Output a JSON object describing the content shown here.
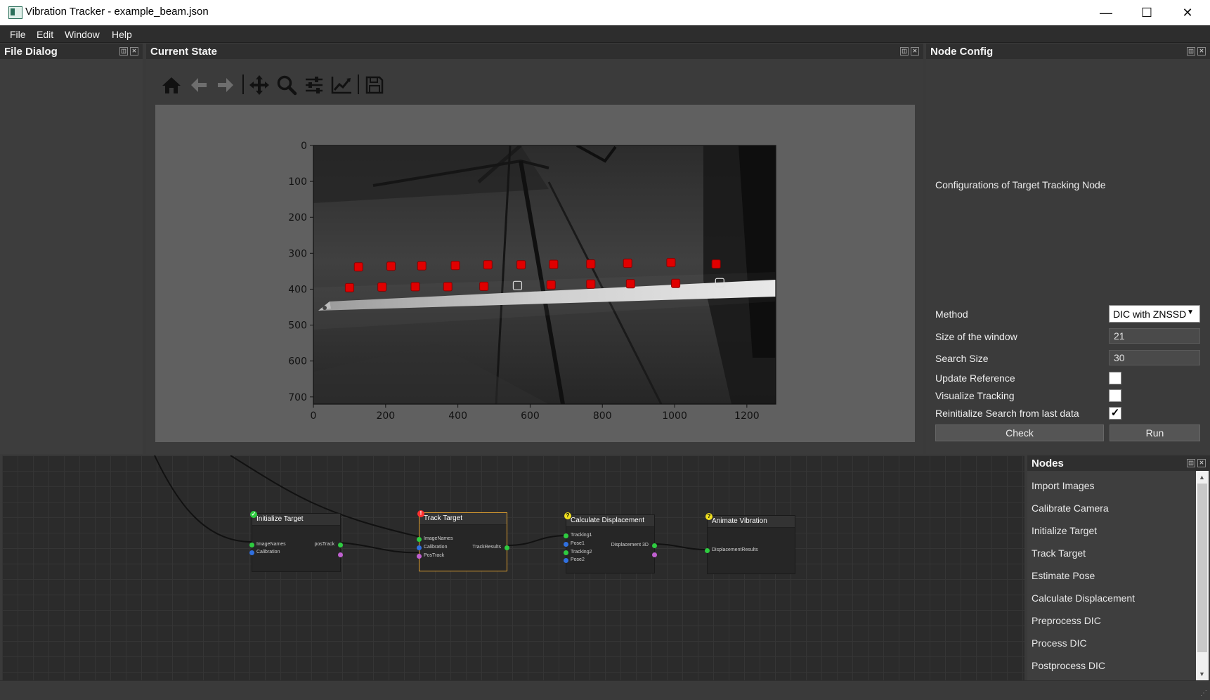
{
  "window": {
    "title": "Vibration Tracker - example_beam.json",
    "minimize_glyph": "—",
    "maximize_glyph": "☐",
    "close_glyph": "✕"
  },
  "menu": [
    "File",
    "Edit",
    "Window",
    "Help"
  ],
  "panels": {
    "file_dialog": "File Dialog",
    "current_state": "Current State",
    "node_config": "Node Config",
    "nodes": "Nodes"
  },
  "toolbar": {
    "icons": [
      "home-icon",
      "back-arrow-icon",
      "forward-arrow-icon",
      "pan-icon",
      "zoom-icon",
      "configure-subplots-icon",
      "edit-axis-icon",
      "save-icon"
    ]
  },
  "chart_data": {
    "type": "image",
    "x_ticks": [
      "0",
      "200",
      "400",
      "600",
      "800",
      "1000",
      "1200"
    ],
    "y_ticks": [
      "0",
      "100",
      "200",
      "300",
      "400",
      "500",
      "600",
      "700"
    ],
    "xlim": [
      0,
      1280
    ],
    "ylim": [
      720,
      0
    ],
    "markers_top_row": [
      {
        "x": 125,
        "y": 338
      },
      {
        "x": 215,
        "y": 336
      },
      {
        "x": 300,
        "y": 335
      },
      {
        "x": 393,
        "y": 334
      },
      {
        "x": 483,
        "y": 332
      },
      {
        "x": 575,
        "y": 332
      },
      {
        "x": 665,
        "y": 331
      },
      {
        "x": 768,
        "y": 330
      },
      {
        "x": 870,
        "y": 328
      },
      {
        "x": 990,
        "y": 326
      },
      {
        "x": 1115,
        "y": 330
      }
    ],
    "markers_bottom_row": [
      {
        "x": 100,
        "y": 396
      },
      {
        "x": 190,
        "y": 394
      },
      {
        "x": 282,
        "y": 393
      },
      {
        "x": 372,
        "y": 393
      },
      {
        "x": 472,
        "y": 392
      },
      {
        "x": 565,
        "y": 390
      },
      {
        "x": 658,
        "y": 388
      },
      {
        "x": 768,
        "y": 386
      },
      {
        "x": 878,
        "y": 385
      },
      {
        "x": 1003,
        "y": 384
      },
      {
        "x": 1125,
        "y": 382
      }
    ],
    "hollow_markers": [
      {
        "x": 565,
        "y": 390
      },
      {
        "x": 1125,
        "y": 382
      }
    ],
    "marker_color": "#e00000"
  },
  "node_config": {
    "description": "Configurations of Target Tracking Node",
    "method_label": "Method",
    "method_value": "DIC with ZNSSD",
    "window_label": "Size of the window",
    "window_value": "21",
    "search_label": "Search Size",
    "search_value": "30",
    "update_ref_label": "Update Reference",
    "update_ref_checked": false,
    "visualize_label": "Visualize Tracking",
    "visualize_checked": false,
    "reinit_label": "Reinitialize Search from last data",
    "reinit_checked": true,
    "reinit_mark": "✓",
    "check_button": "Check",
    "run_button": "Run"
  },
  "graph": {
    "nodes": [
      {
        "title": "Initialize Target",
        "inputs": [
          "ImageNames",
          "Calibration"
        ],
        "outputs": [
          "posTrack"
        ],
        "status": "ok",
        "status_glyph": "✓",
        "status_color": "#2ecc40"
      },
      {
        "title": "Track Target",
        "inputs": [
          "ImageNames",
          "Calibration",
          "PosTrack"
        ],
        "outputs": [
          "TrackResults"
        ],
        "status": "error",
        "status_glyph": "!",
        "status_color": "#ff3030"
      },
      {
        "title": "Calculate Displacement",
        "inputs": [
          "Tracking1",
          "Pose1",
          "Tracking2",
          "Pose2"
        ],
        "outputs": [
          "Displacement 3D"
        ],
        "status": "pending",
        "status_glyph": "?",
        "status_color": "#f0e020"
      },
      {
        "title": "Animate Vibration",
        "inputs": [
          "DisplacementResults"
        ],
        "outputs": [],
        "status": "pending",
        "status_glyph": "?",
        "status_color": "#f0e020"
      }
    ]
  },
  "nodes_list": [
    "Import Images",
    "Calibrate Camera",
    "Initialize Target",
    "Track Target",
    "Estimate Pose",
    "Calculate Displacement",
    "Preprocess DIC",
    "Process DIC",
    "Postprocess DIC"
  ]
}
